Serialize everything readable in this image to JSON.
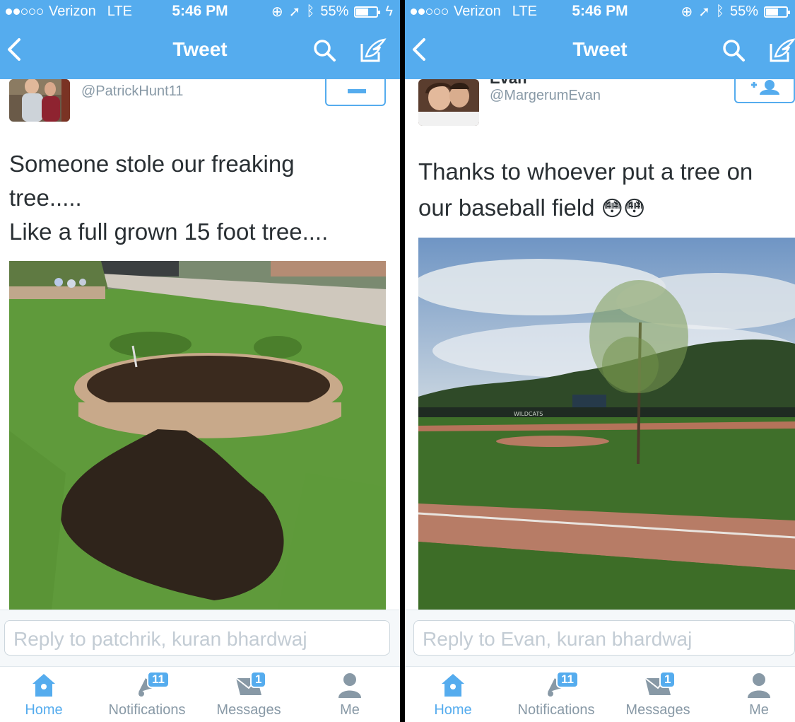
{
  "colors": {
    "accent": "#55acee",
    "text": "#292f33",
    "muted": "#8899a6",
    "placeholder": "#c3ccd4"
  },
  "left": {
    "status": {
      "carrier": "Verizon",
      "network": "LTE",
      "time": "5:46 PM",
      "battery": "55%"
    },
    "nav": {
      "title": "Tweet",
      "back_icon": "chevron-left-icon",
      "search_icon": "search-icon",
      "compose_icon": "compose-icon"
    },
    "tweet": {
      "handle": "@PatrickHunt11",
      "lines": [
        "Someone stole our freaking",
        "tree.....",
        "Like a full grown 15 foot tree...."
      ]
    },
    "reply": {
      "placeholder": "Reply to patchrik, kuran bhardwaj"
    },
    "tabs": [
      {
        "label": "Home",
        "icon": "home-icon"
      },
      {
        "label": "Notifications",
        "icon": "bell-icon",
        "badge": "11"
      },
      {
        "label": "Messages",
        "icon": "envelope-icon",
        "badge": "1"
      },
      {
        "label": "Me",
        "icon": "person-icon"
      }
    ]
  },
  "right": {
    "status": {
      "carrier": "Verizon",
      "network": "LTE",
      "time": "5:46 PM",
      "battery": "55%"
    },
    "nav": {
      "title": "Tweet",
      "back_icon": "chevron-left-icon",
      "search_icon": "search-icon",
      "compose_icon": "compose-icon"
    },
    "tweet": {
      "name": "Evan",
      "handle": "@MargerumEvan",
      "lines": [
        "Thanks to whoever put a tree on",
        "our baseball field"
      ],
      "emoji": "😳😳",
      "scoreboard_text": "WILDCATS"
    },
    "reply": {
      "placeholder": "Reply to Evan, kuran bhardwaj"
    },
    "tabs": [
      {
        "label": "Home",
        "icon": "home-icon"
      },
      {
        "label": "Notifications",
        "icon": "bell-icon",
        "badge": "11"
      },
      {
        "label": "Messages",
        "icon": "envelope-icon",
        "badge": "1"
      },
      {
        "label": "Me",
        "icon": "person-icon"
      }
    ]
  }
}
